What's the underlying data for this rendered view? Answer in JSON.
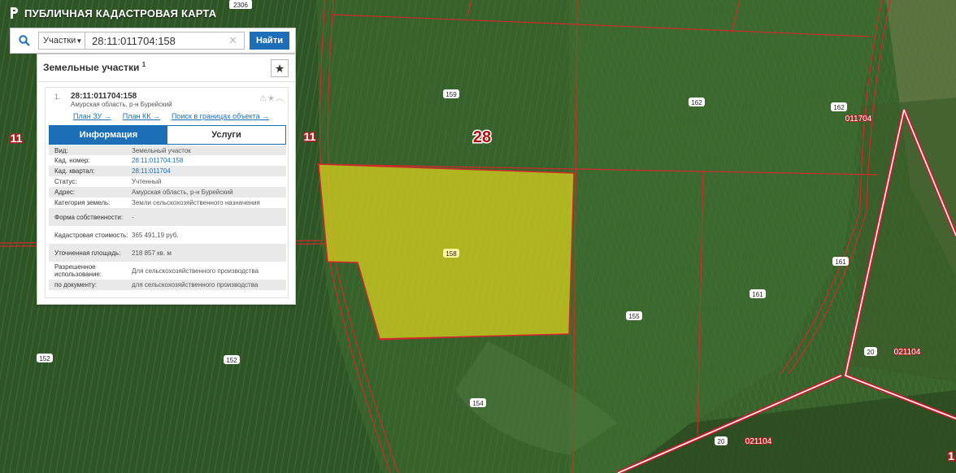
{
  "app": {
    "title": "ПУБЛИЧНАЯ КАДАСТРОВАЯ КАРТА"
  },
  "search": {
    "type_label": "Участки",
    "query": "28:11:011704:158",
    "find_label": "Найти"
  },
  "panel": {
    "title": "Земельные участки",
    "count": "1",
    "item": {
      "number": "1.",
      "cad_number": "28:11:011704:158",
      "address": "Амурская область, р-н Бурейский",
      "links": [
        "План ЗУ →",
        "План КК →",
        "Поиск в границах объекта →"
      ]
    },
    "tabs": [
      "Информация",
      "Услуги"
    ],
    "rows": [
      {
        "label": "Вид:",
        "value": "Земельный участок"
      },
      {
        "label": "Кад. номер:",
        "value": "28:11:011704:158",
        "link": true
      },
      {
        "label": "Кад. квартал:",
        "value": "28:11:011704",
        "link": true
      },
      {
        "label": "Статус:",
        "value": "Учтенный"
      },
      {
        "label": "Адрес:",
        "value": "Амурская область, р-н Бурейский"
      },
      {
        "label": "Категория земель:",
        "value": "Земли сельскохозяйственного назначения"
      },
      {
        "label": "Форма собственности:",
        "value": "-"
      },
      {
        "label": "Кадастровая стоимость:",
        "value": "365 491,19 руб."
      },
      {
        "label": "Уточненная площадь:",
        "value": "218 857 кв. м"
      },
      {
        "label": "Разрешенное использование:",
        "value": "Для сельскохозяйственного производства"
      },
      {
        "label": "по документу:",
        "value": "для сельскохозяйственного производства"
      }
    ]
  },
  "map_labels": {
    "district_28": "28",
    "district_11_left": "11",
    "district_11_mid": "11",
    "plot_159": "159",
    "plot_162a": "162",
    "plot_162b": "162",
    "quarter_011704": "011704",
    "plot_158": "158",
    "plot_161a": "161",
    "plot_161b": "161",
    "plot_155": "155",
    "plot_152a": "152",
    "plot_152b": "152",
    "plot_154": "154",
    "num_20a": "20",
    "quarter_021104a": "021104",
    "num_20b": "20",
    "quarter_021104b": "021104",
    "num_2306": "2306",
    "edge_1": "1"
  },
  "colors": {
    "accent": "#1c6fb7",
    "boundary": "#d12a2a",
    "selected_fill": "#d7d21e"
  }
}
